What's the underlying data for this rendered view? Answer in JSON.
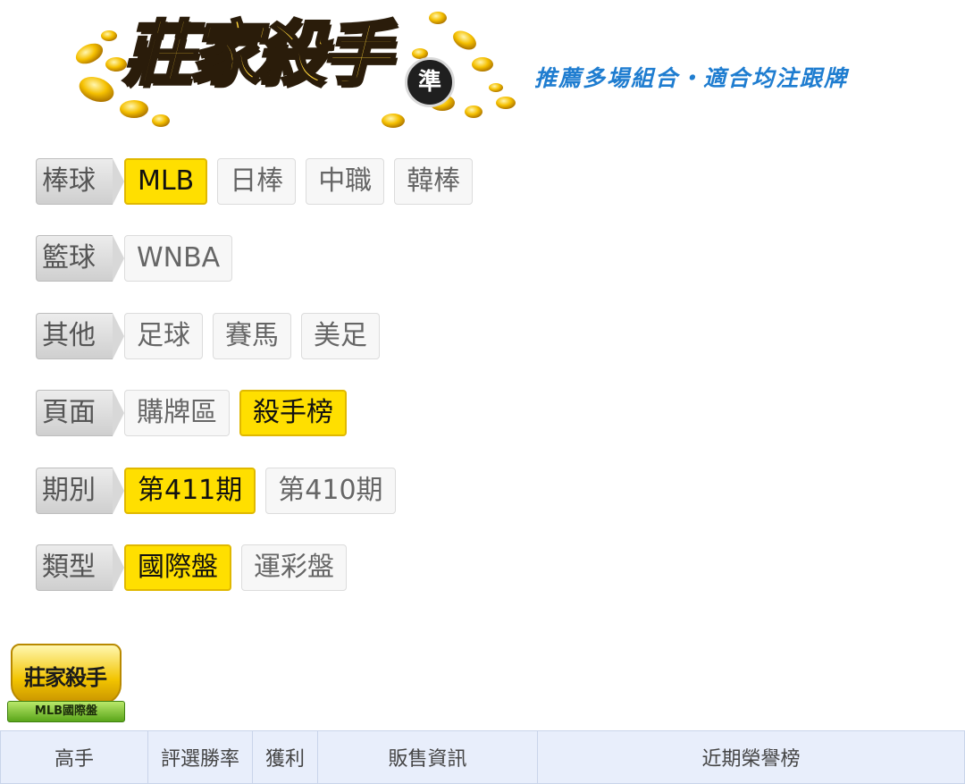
{
  "banner": {
    "logo_text": "莊家殺手",
    "logo_badge": "準",
    "slogan": "推薦多場組合・適合均注跟牌"
  },
  "filters": [
    {
      "label": "棒球",
      "options": [
        {
          "text": "MLB",
          "active": true
        },
        {
          "text": "日棒",
          "active": false
        },
        {
          "text": "中職",
          "active": false
        },
        {
          "text": "韓棒",
          "active": false
        }
      ]
    },
    {
      "label": "籃球",
      "options": [
        {
          "text": "WNBA",
          "active": false
        }
      ]
    },
    {
      "label": "其他",
      "options": [
        {
          "text": "足球",
          "active": false
        },
        {
          "text": "賽馬",
          "active": false
        },
        {
          "text": "美足",
          "active": false
        }
      ]
    },
    {
      "label": "頁面",
      "options": [
        {
          "text": "購牌區",
          "active": false
        },
        {
          "text": "殺手榜",
          "active": true
        }
      ]
    },
    {
      "label": "期別",
      "options": [
        {
          "text": "第411期",
          "active": true
        },
        {
          "text": "第410期",
          "active": false
        }
      ]
    },
    {
      "label": "類型",
      "options": [
        {
          "text": "國際盤",
          "active": true
        },
        {
          "text": "運彩盤",
          "active": false
        }
      ]
    }
  ],
  "badge": {
    "title": "莊家殺手",
    "ribbon": "MLB國際盤"
  },
  "table": {
    "headers": [
      "高手",
      "評選勝率",
      "獲利",
      "販售資訊",
      "近期榮譽榜"
    ]
  },
  "colors": {
    "active_bg": "#ffdf00",
    "slogan": "#1f7dd0",
    "table_header_bg": "#e8eefb"
  }
}
